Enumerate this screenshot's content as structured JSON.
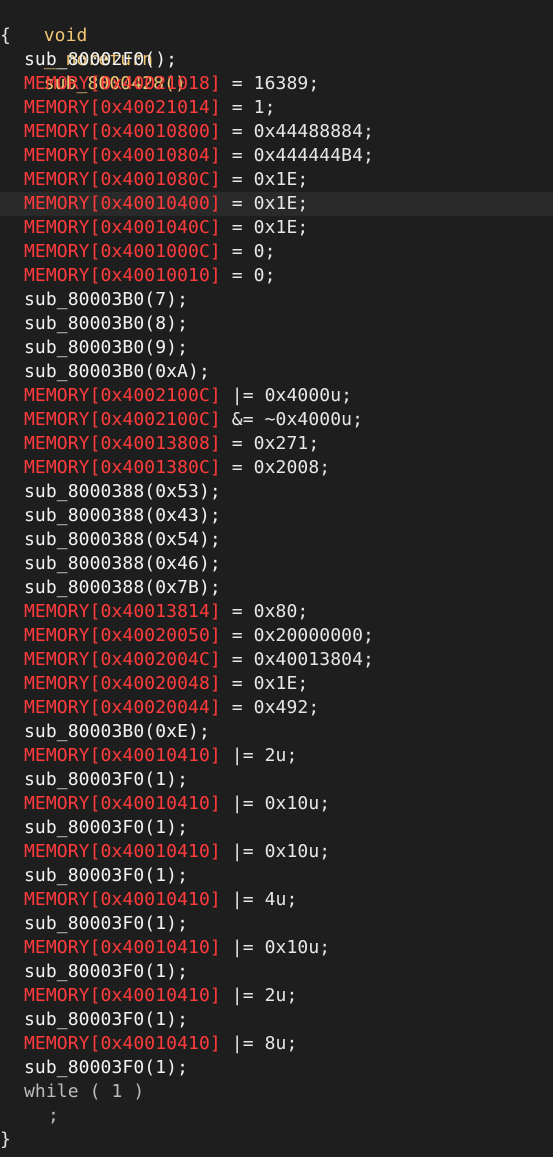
{
  "editor": {
    "signature": {
      "keyword": "void",
      "modifier": "__noreturn",
      "name": "sub_8000428()"
    },
    "open_brace": "{",
    "close_brace": "}",
    "lines": [
      {
        "type": "call",
        "text": "sub_80002F0();"
      },
      {
        "type": "mem",
        "addr": "MEMORY[0x40021018]",
        "rest": " = 16389;"
      },
      {
        "type": "mem",
        "addr": "MEMORY[0x40021014]",
        "rest": " = 1;"
      },
      {
        "type": "mem",
        "addr": "MEMORY[0x40010800]",
        "rest": " = 0x44488884;"
      },
      {
        "type": "mem",
        "addr": "MEMORY[0x40010804]",
        "rest": " = 0x444444B4;"
      },
      {
        "type": "mem",
        "addr": "MEMORY[0x4001080C]",
        "rest": " = 0x1E;"
      },
      {
        "type": "mem",
        "addr": "MEMORY[0x40010400]",
        "rest": " = 0x1E;",
        "highlighted": true
      },
      {
        "type": "mem",
        "addr": "MEMORY[0x4001040C]",
        "rest": " = 0x1E;"
      },
      {
        "type": "mem",
        "addr": "MEMORY[0x4001000C]",
        "rest": " = 0;"
      },
      {
        "type": "mem",
        "addr": "MEMORY[0x40010010]",
        "rest": " = 0;"
      },
      {
        "type": "call",
        "text": "sub_80003B0(7);"
      },
      {
        "type": "call",
        "text": "sub_80003B0(8);"
      },
      {
        "type": "call",
        "text": "sub_80003B0(9);"
      },
      {
        "type": "call",
        "text": "sub_80003B0(0xA);"
      },
      {
        "type": "mem",
        "addr": "MEMORY[0x4002100C]",
        "rest": " |= 0x4000u;"
      },
      {
        "type": "mem",
        "addr": "MEMORY[0x4002100C]",
        "rest": " &= ~0x4000u;"
      },
      {
        "type": "mem",
        "addr": "MEMORY[0x40013808]",
        "rest": " = 0x271;"
      },
      {
        "type": "mem",
        "addr": "MEMORY[0x4001380C]",
        "rest": " = 0x2008;"
      },
      {
        "type": "call",
        "text": "sub_8000388(0x53);"
      },
      {
        "type": "call",
        "text": "sub_8000388(0x43);"
      },
      {
        "type": "call",
        "text": "sub_8000388(0x54);"
      },
      {
        "type": "call",
        "text": "sub_8000388(0x46);"
      },
      {
        "type": "call",
        "text": "sub_8000388(0x7B);"
      },
      {
        "type": "mem",
        "addr": "MEMORY[0x40013814]",
        "rest": " = 0x80;"
      },
      {
        "type": "mem",
        "addr": "MEMORY[0x40020050]",
        "rest": " = 0x20000000;"
      },
      {
        "type": "mem",
        "addr": "MEMORY[0x4002004C]",
        "rest": " = 0x40013804;"
      },
      {
        "type": "mem",
        "addr": "MEMORY[0x40020048]",
        "rest": " = 0x1E;"
      },
      {
        "type": "mem",
        "addr": "MEMORY[0x40020044]",
        "rest": " = 0x492;"
      },
      {
        "type": "call",
        "text": "sub_80003B0(0xE);"
      },
      {
        "type": "mem",
        "addr": "MEMORY[0x40010410]",
        "rest": " |= 2u;"
      },
      {
        "type": "call",
        "text": "sub_80003F0(1);"
      },
      {
        "type": "mem",
        "addr": "MEMORY[0x40010410]",
        "rest": " |= 0x10u;"
      },
      {
        "type": "call",
        "text": "sub_80003F0(1);"
      },
      {
        "type": "mem",
        "addr": "MEMORY[0x40010410]",
        "rest": " |= 0x10u;"
      },
      {
        "type": "call",
        "text": "sub_80003F0(1);"
      },
      {
        "type": "mem",
        "addr": "MEMORY[0x40010410]",
        "rest": " |= 4u;"
      },
      {
        "type": "call",
        "text": "sub_80003F0(1);"
      },
      {
        "type": "mem",
        "addr": "MEMORY[0x40010410]",
        "rest": " |= 0x10u;"
      },
      {
        "type": "call",
        "text": "sub_80003F0(1);"
      },
      {
        "type": "mem",
        "addr": "MEMORY[0x40010410]",
        "rest": " |= 2u;"
      },
      {
        "type": "call",
        "text": "sub_80003F0(1);"
      },
      {
        "type": "mem",
        "addr": "MEMORY[0x40010410]",
        "rest": " |= 8u;"
      },
      {
        "type": "call",
        "text": "sub_80003F0(1);"
      },
      {
        "type": "loop",
        "text": "while ( 1 )"
      },
      {
        "type": "body",
        "text": ";"
      }
    ]
  },
  "colors": {
    "background": "#1e1e1e",
    "keyword": "#f0c674",
    "memory": "#ff3b3b",
    "text": "#e6e6e6",
    "highlight": "#2a2a2a"
  }
}
